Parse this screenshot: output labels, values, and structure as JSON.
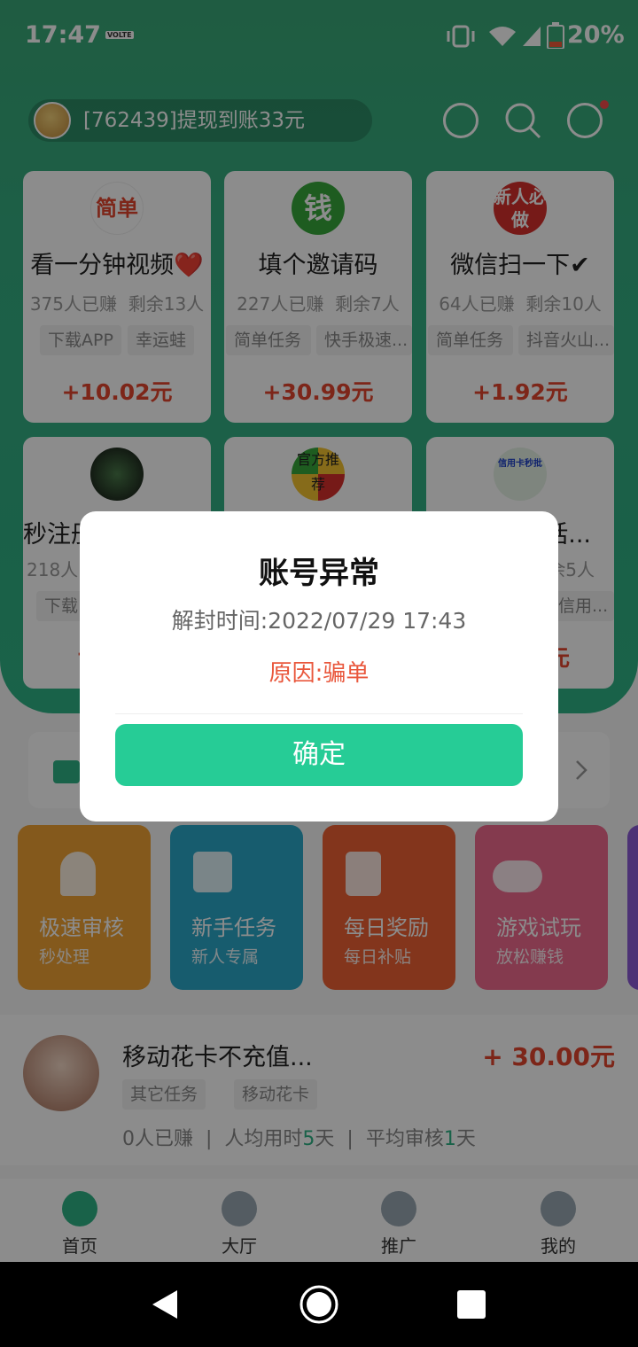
{
  "status_bar": {
    "time": "17:47",
    "volte": "VOLTE",
    "battery": "20%"
  },
  "ticker": {
    "text": "[762439]提现到账33元"
  },
  "header_icons": [
    "share-icon",
    "search-icon",
    "camera-icon"
  ],
  "tasks": [
    {
      "badge": "简单",
      "title": "看一分钟视频❤️",
      "earned": "375人已赚",
      "remain": "剩余13人",
      "tags": [
        "下载APP",
        "幸运蛙"
      ],
      "price": "+10.02元"
    },
    {
      "badge": "钱",
      "title": "填个邀请码",
      "earned": "227人已赚",
      "remain": "剩余7人",
      "tags": [
        "简单任务",
        "快手极速..."
      ],
      "price": "+30.99元"
    },
    {
      "badge": "新人必做",
      "title": "微信扫一下✔",
      "earned": "64人已赚",
      "remain": "剩余10人",
      "tags": [
        "简单任务",
        "抖音火山..."
      ],
      "price": "+1.92元"
    },
    {
      "badge": "",
      "title": "秒注册",
      "earned": "218人",
      "remain": "",
      "tags": [
        "下载"
      ],
      "price": "+"
    },
    {
      "badge": "官方推荐",
      "title": "",
      "earned": "",
      "remain": "",
      "tags": [],
      "price": ""
    },
    {
      "badge": "信用卡秒批",
      "title": "话...",
      "earned": "",
      "remain": "余5人",
      "tags": [
        "信用..."
      ],
      "price": "元"
    }
  ],
  "tiles": [
    {
      "title": "极速审核",
      "sub": "秒处理",
      "color": "#f0a334"
    },
    {
      "title": "新手任务",
      "sub": "新人专属",
      "color": "#2aa8c9"
    },
    {
      "title": "每日奖励",
      "sub": "每日补贴",
      "color": "#ee6233"
    },
    {
      "title": "游戏试玩",
      "sub": "放松赚钱",
      "color": "#f06a8f"
    }
  ],
  "list_item": {
    "title": "移动花卡不充值...",
    "price": "+ 30.00元",
    "tags": [
      "其它任务",
      "移动花卡"
    ],
    "earned": "0人已赚",
    "avg_time_label": "人均用时",
    "avg_time_value": "5",
    "avg_time_unit": "天",
    "avg_review_label": "平均审核",
    "avg_review_value": "1",
    "avg_review_unit": "天"
  },
  "tabs": [
    {
      "label": "首页"
    },
    {
      "label": "大厅"
    },
    {
      "label": "推广"
    },
    {
      "label": "我的"
    }
  ],
  "dialog": {
    "title": "账号异常",
    "unlock_time": "解封时间:2022/07/29 17:43",
    "reason": "原因:骗单",
    "confirm": "确定"
  }
}
